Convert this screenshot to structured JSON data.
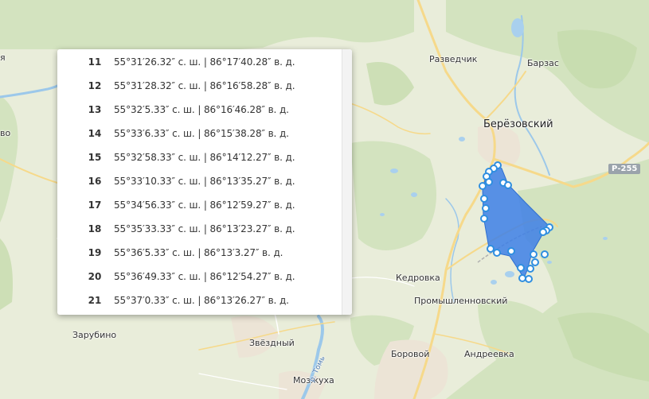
{
  "map": {
    "labels": {
      "razvedchik": "Разведчик",
      "barzas": "Барзас",
      "berezovsky": "Берёзовский",
      "kedrovka": "Кедровка",
      "promyshlennovsky": "Промышленновский",
      "zarubino": "Зарубино",
      "zvezdny": "Звёздный",
      "borovoy": "Боровой",
      "andreevka": "Андреевка",
      "mozzhukha": "Мозжуха",
      "river_tom": "р. Томь",
      "left_fragment_1": "я",
      "left_fragment_2": "во"
    },
    "road_shield": "Р-255",
    "colors": {
      "polygon_fill": "#3d7fe6",
      "marker": "#2f8ee0",
      "water": "#9cc8ea"
    }
  },
  "coordinates_panel": {
    "rows": [
      {
        "num": "11",
        "text": "55°31′26.32″ с. ш. | 86°17′40.28″ в. д."
      },
      {
        "num": "12",
        "text": "55°31′28.32″ с. ш. | 86°16′58.28″ в. д."
      },
      {
        "num": "13",
        "text": "55°32′5.33″ с. ш. | 86°16′46.28″ в. д."
      },
      {
        "num": "14",
        "text": "55°33′6.33″ с. ш. | 86°15′38.28″ в. д."
      },
      {
        "num": "15",
        "text": "55°32′58.33″ с. ш. | 86°14′12.27″ в. д."
      },
      {
        "num": "16",
        "text": "55°33′10.33″ с. ш. | 86°13′35.27″ в. д."
      },
      {
        "num": "17",
        "text": "55°34′56.33″ с. ш. | 86°12′59.27″ в. д."
      },
      {
        "num": "18",
        "text": "55°35′33.33″ с. ш. | 86°13′23.27″ в. д."
      },
      {
        "num": "19",
        "text": "55°36′5.33″ с. ш. | 86°13′3.27″ в. д."
      },
      {
        "num": "20",
        "text": "55°36′49.33″ с. ш. | 86°12′54.27″ в. д."
      },
      {
        "num": "21",
        "text": "55°37′0.33″ с. ш. | 86°13′26.27″ в. д."
      }
    ]
  }
}
